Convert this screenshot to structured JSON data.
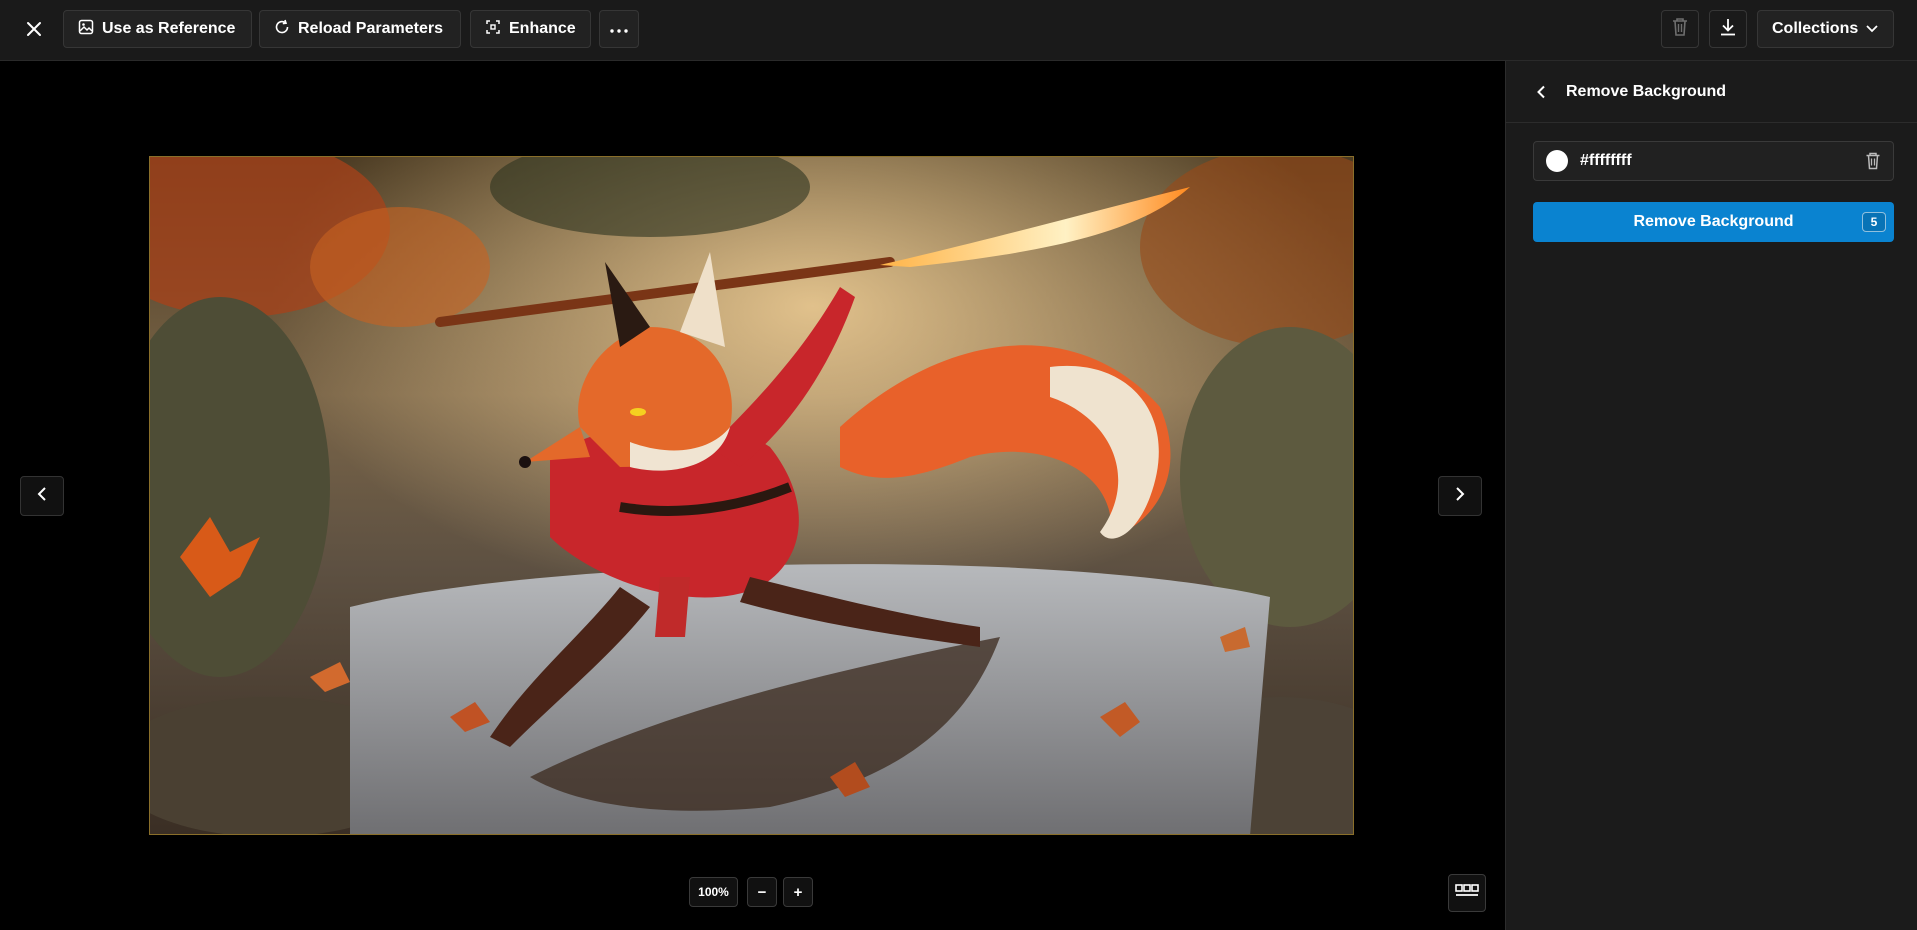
{
  "toolbar": {
    "close_icon": "close-icon",
    "use_as_reference": "Use as Reference",
    "reload_parameters": "Reload Parameters",
    "enhance": "Enhance",
    "more_icon": "ellipsis-icon",
    "delete_icon": "trash-icon",
    "download_icon": "download-icon",
    "collections": "Collections"
  },
  "viewer": {
    "image_description": "Anthropomorphic fox warrior in red robe wielding a flaming spear over a forest pond with autumn leaves",
    "zoom_level": "100%",
    "zoom_out": "−",
    "zoom_in": "+"
  },
  "panel": {
    "title": "Remove Background",
    "color_value": "#ffffffff",
    "action_label": "Remove Background",
    "cost": "5"
  },
  "colors": {
    "accent": "#0a83d0",
    "topbar_bg": "#1a1a1a",
    "panel_bg": "#1b1b1b"
  }
}
